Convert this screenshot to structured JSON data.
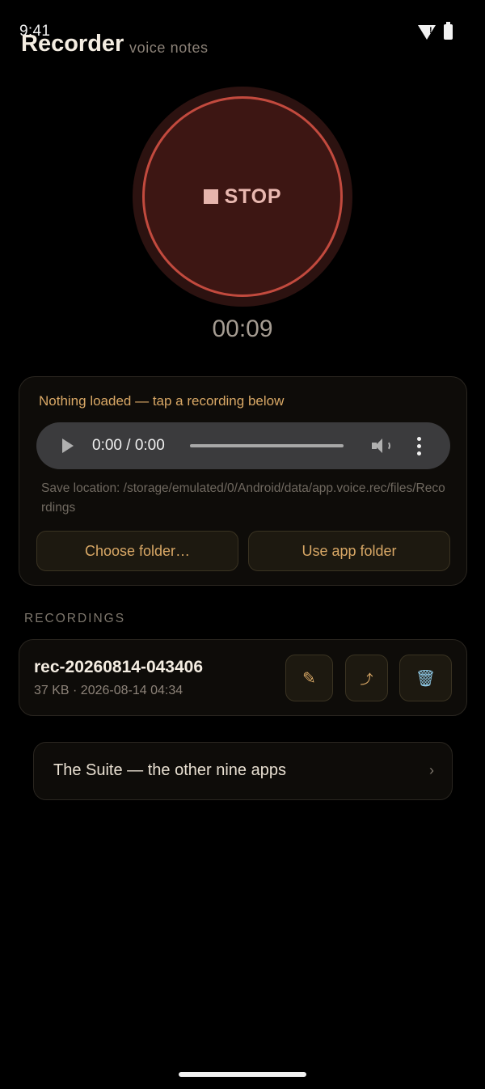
{
  "status_bar": {
    "time": "9:41"
  },
  "app": {
    "title": "Recorder",
    "subtitle": "voice notes"
  },
  "recorder": {
    "button_label": "STOP",
    "elapsed": "00:09"
  },
  "player": {
    "status": "Nothing loaded — tap a recording below",
    "time": "0:00 / 0:00",
    "save_location": "Save location: /storage/emulated/0/Android/data/app.voice.rec/files/Recordings",
    "choose_folder_label": "Choose folder…",
    "use_app_folder_label": "Use app folder"
  },
  "recordings": {
    "section_label": "RECORDINGS",
    "items": [
      {
        "name": "rec-20260814-043406",
        "meta": "37 KB · 2026-08-14 04:34",
        "rename_icon": "✎",
        "share_icon": "⤴",
        "delete_icon": "🗑"
      }
    ]
  },
  "suite": {
    "label": "The Suite — the other nine apps",
    "chevron": "›"
  }
}
